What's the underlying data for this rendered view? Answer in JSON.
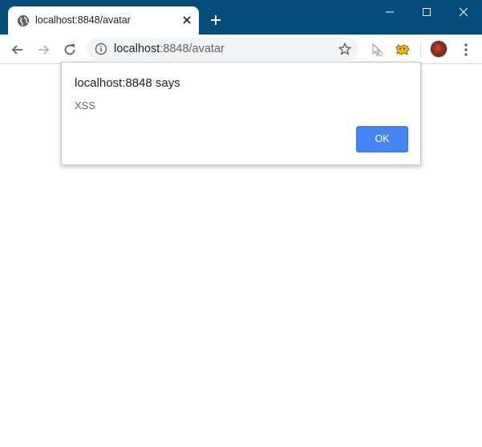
{
  "colors": {
    "titlebar": "#034B78",
    "accent_button": "#4285f4",
    "text_primary": "#202124",
    "text_secondary": "#5f6368"
  },
  "tab": {
    "title": "localhost:8848/avatar",
    "favicon": "globe-icon"
  },
  "toolbar": {
    "url_host": "localhost",
    "url_rest": ":8848/avatar",
    "icons": [
      "back-arrow-icon",
      "forward-arrow-icon",
      "reload-icon",
      "info-icon",
      "star-icon",
      "extension-cursor-icon",
      "extension-tamper-icon",
      "avatar",
      "kebab-menu-icon"
    ]
  },
  "window_controls": [
    "minimize-icon",
    "maximize-icon",
    "close-icon"
  ],
  "dialog": {
    "title": "localhost:8848 says",
    "message": "XSS",
    "ok_label": "OK"
  }
}
